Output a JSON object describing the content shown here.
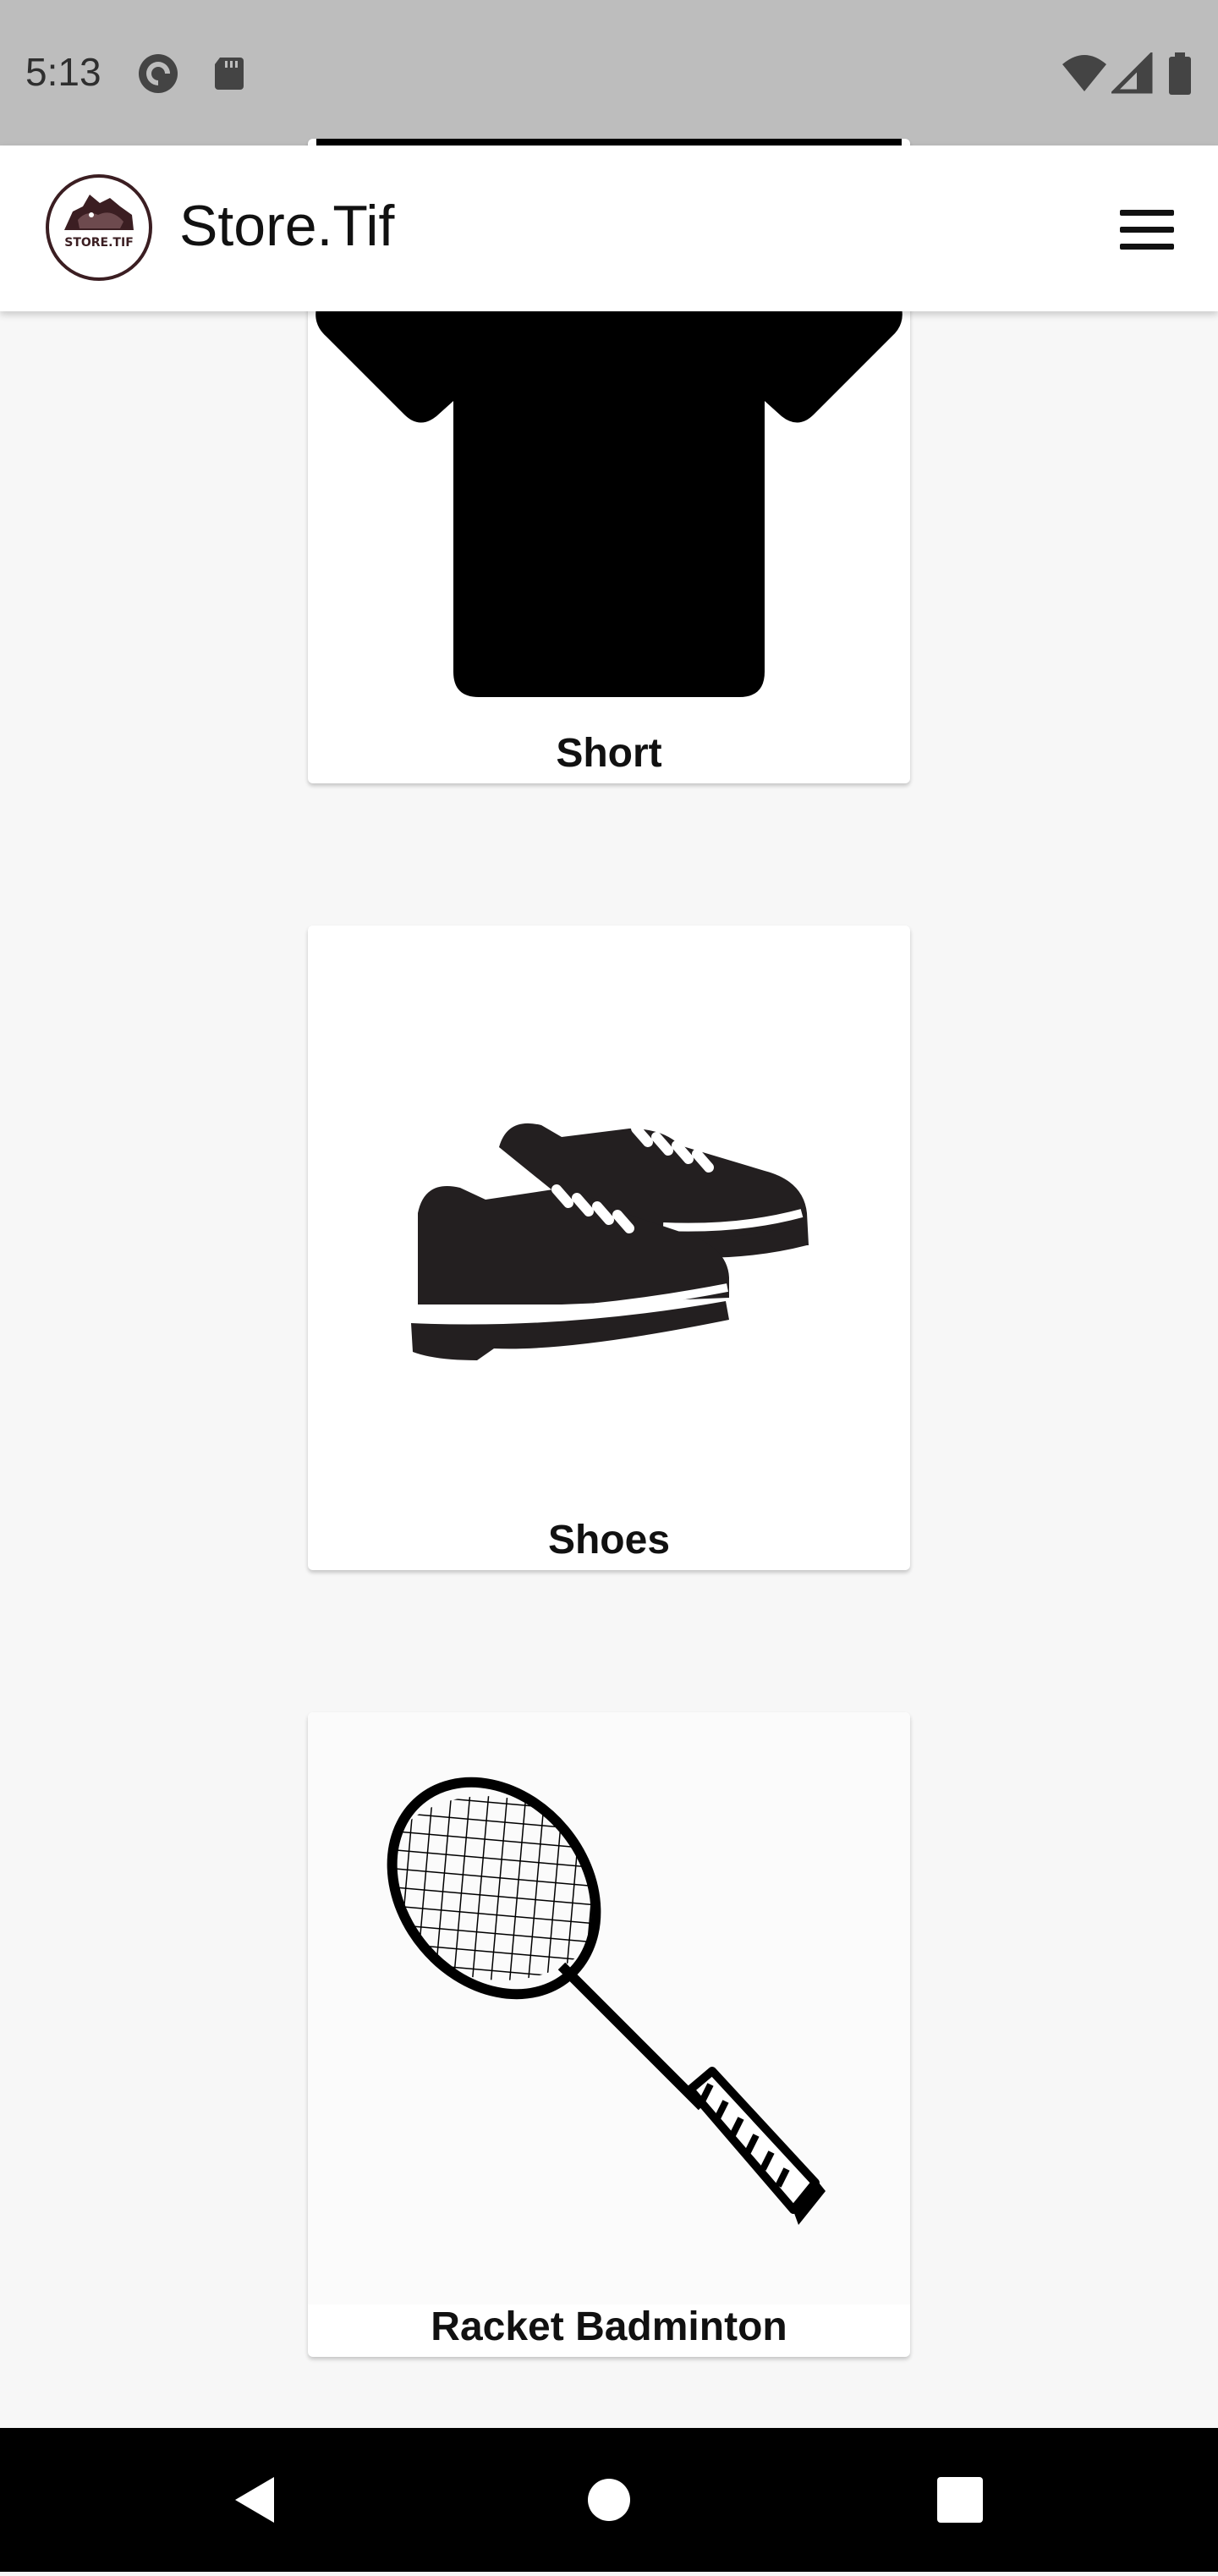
{
  "status_bar": {
    "time": "5:13",
    "left_icons": [
      "pocket-casts-icon",
      "sd-card-icon"
    ],
    "right_icons": [
      "wifi-icon",
      "signal-icon",
      "battery-icon"
    ]
  },
  "app_bar": {
    "logo_text": "STORE.TIF",
    "title": "Store.Tif",
    "menu_icon": "hamburger-menu-icon"
  },
  "products": [
    {
      "name": "Short",
      "icon": "tshirt-icon"
    },
    {
      "name": "Shoes",
      "icon": "shoes-icon"
    },
    {
      "name": "Racket Badminton",
      "icon": "badminton-racket-icon"
    }
  ],
  "nav_bar": {
    "buttons": [
      "back-icon",
      "home-icon",
      "recents-icon"
    ]
  },
  "colors": {
    "status_bar_bg": "#bdbdbd",
    "app_bar_bg": "#ffffff",
    "page_bg": "#f7f7f7",
    "logo_accent": "#3b1e22",
    "nav_bar_bg": "#000000"
  }
}
